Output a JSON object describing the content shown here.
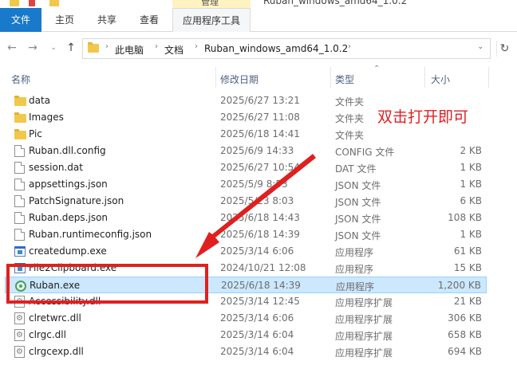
{
  "window": {
    "title": "Ruban_windows_amd64_1.0.2",
    "manage_tab_label": "管理"
  },
  "ribbon": {
    "tabs": [
      {
        "label": "文件",
        "active": true
      },
      {
        "label": "主页"
      },
      {
        "label": "共享"
      },
      {
        "label": "查看"
      },
      {
        "label": "应用程序工具"
      }
    ]
  },
  "address": {
    "crumbs": [
      "此电脑",
      "文档",
      "Ruban_windows_amd64_1.0.2"
    ]
  },
  "columns": {
    "name": "名称",
    "date": "修改日期",
    "type": "类型",
    "size": "大小"
  },
  "files": [
    {
      "name": "data",
      "date": "2025/6/27 13:21",
      "type": "文件夹",
      "size": "",
      "icon": "folder-icon"
    },
    {
      "name": "Images",
      "date": "2025/6/27 11:08",
      "type": "文件夹",
      "size": "",
      "icon": "folder-icon"
    },
    {
      "name": "Pic",
      "date": "2025/6/18 14:41",
      "type": "文件夹",
      "size": "",
      "icon": "folder-icon"
    },
    {
      "name": "Ruban.dll.config",
      "date": "2025/6/9 14:33",
      "type": "CONFIG 文件",
      "size": "2 KB",
      "icon": "file-icon"
    },
    {
      "name": "session.dat",
      "date": "2025/6/27 10:54",
      "type": "DAT 文件",
      "size": "1 KB",
      "icon": "file-icon"
    },
    {
      "name": "appsettings.json",
      "date": "2025/5/9 8:53",
      "type": "JSON 文件",
      "size": "1 KB",
      "icon": "file-icon"
    },
    {
      "name": "PatchSignature.json",
      "date": "2025/5/23 8:03",
      "type": "JSON 文件",
      "size": "6 KB",
      "icon": "file-icon"
    },
    {
      "name": "Ruban.deps.json",
      "date": "2025/6/18 14:43",
      "type": "JSON 文件",
      "size": "108 KB",
      "icon": "file-icon"
    },
    {
      "name": "Ruban.runtimeconfig.json",
      "date": "2025/6/18 14:39",
      "type": "JSON 文件",
      "size": "1 KB",
      "icon": "file-icon"
    },
    {
      "name": "createdump.exe",
      "date": "2025/3/14 6:06",
      "type": "应用程序",
      "size": "61 KB",
      "icon": "exe-icon"
    },
    {
      "name": "File2Clipboard.exe",
      "date": "2024/10/21 12:08",
      "type": "应用程序",
      "size": "15 KB",
      "icon": "exe-icon"
    },
    {
      "name": "Ruban.exe",
      "date": "2025/6/18 14:39",
      "type": "应用程序",
      "size": "1,200 KB",
      "icon": "ruban-app-icon",
      "selected": true
    },
    {
      "name": "Accessibility.dll",
      "date": "2025/3/14 12:45",
      "type": "应用程序扩展",
      "size": "21 KB",
      "icon": "dll-icon"
    },
    {
      "name": "clretwrc.dll",
      "date": "2025/3/14 6:06",
      "type": "应用程序扩展",
      "size": "306 KB",
      "icon": "dll-icon"
    },
    {
      "name": "clrgc.dll",
      "date": "2025/3/14 6:04",
      "type": "应用程序扩展",
      "size": "658 KB",
      "icon": "dll-icon"
    },
    {
      "name": "clrgcexp.dll",
      "date": "2025/3/14 6:04",
      "type": "应用程序扩展",
      "size": "694 KB",
      "icon": "dll-icon"
    }
  ],
  "annotation": {
    "text": "双击打开即可",
    "color": "#e02020"
  },
  "colors": {
    "file_tab": "#1979ca",
    "selection": "#cce8ff",
    "manage_tab": "#fff3c2"
  }
}
